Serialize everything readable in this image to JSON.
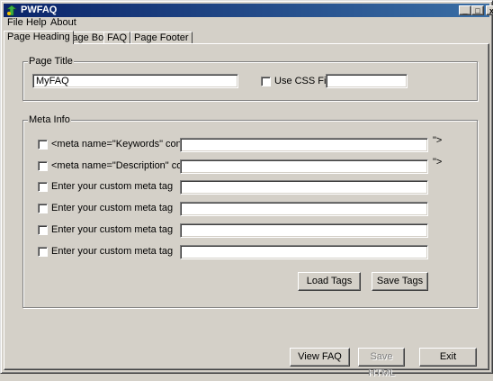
{
  "window": {
    "title": "PWFAQ",
    "minimize": "_",
    "maximize": "□",
    "close": "x"
  },
  "menu": {
    "file": "File",
    "help": "Help",
    "about": "About"
  },
  "tabs": [
    "Page Heading",
    "Page Body",
    "FAQ",
    "Page Footer"
  ],
  "page_title_group": {
    "label": "Page Title",
    "title_value": "MyFAQ",
    "use_css_label": "Use CSS File",
    "css_value": ""
  },
  "meta_group": {
    "label": "Meta Info",
    "rows": [
      {
        "label": "<meta name=\"Keywords\" content=\"",
        "value": "",
        "suffix": "\">"
      },
      {
        "label": "<meta name=\"Description\" content=\"",
        "value": "",
        "suffix": "\">"
      },
      {
        "label": "Enter your custom meta tag",
        "value": "",
        "suffix": ""
      },
      {
        "label": "Enter your custom meta tag",
        "value": "",
        "suffix": ""
      },
      {
        "label": "Enter your custom meta tag",
        "value": "",
        "suffix": ""
      },
      {
        "label": "Enter your custom meta tag",
        "value": "",
        "suffix": ""
      }
    ],
    "load_tags": "Load Tags",
    "save_tags": "Save Tags"
  },
  "footer_buttons": {
    "view_faq": "View FAQ",
    "save_html": "Save HTML",
    "exit": "Exit"
  }
}
